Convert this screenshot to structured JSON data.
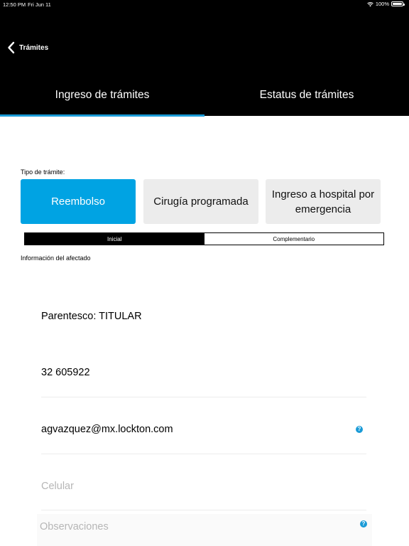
{
  "status_bar": {
    "time": "12:50 PM",
    "date": "Fri Jun 11",
    "battery": "100%"
  },
  "nav": {
    "back_label": "Trámites"
  },
  "tabs": [
    {
      "label": "Ingreso de trámites",
      "active": true
    },
    {
      "label": "Estatus de trámites",
      "active": false
    }
  ],
  "form": {
    "type_label": "Tipo de trámite:",
    "types": [
      {
        "label": "Reembolso",
        "selected": true
      },
      {
        "label": "Cirugía programada",
        "selected": false
      },
      {
        "label": "Ingreso a hospital por emergencia",
        "selected": false
      }
    ],
    "segments": [
      {
        "label": "Inicial",
        "selected": true
      },
      {
        "label": "Complementario",
        "selected": false
      }
    ],
    "affected_label": "Información del afectado",
    "parentesco": "Parentesco: TITULAR",
    "phone": "32 605922",
    "email": "agvazquez@mx.lockton.com",
    "cellular_placeholder": "Celular",
    "observations_placeholder": "Observaciones",
    "help_glyph": "?"
  },
  "colors": {
    "accent": "#00a3e3",
    "header_bg": "#000000",
    "tab_indicator": "#1a9bd7"
  }
}
